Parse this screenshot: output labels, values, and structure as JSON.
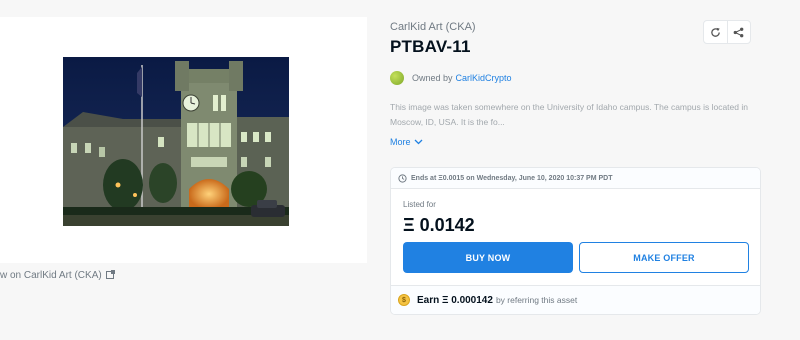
{
  "asset": {
    "collection": "CarlKid Art (CKA)",
    "title": "PTBAV-11",
    "owned_by_prefix": "Owned by",
    "owner": "CarlKidCrypto",
    "description": "This image was taken somewhere on the University of Idaho campus. The campus is located in Moscow, ID, USA. It is the fo...",
    "more_label": "More",
    "view_on_label": "w on CarlKid Art (CKA)"
  },
  "icons": {
    "refresh": "refresh-icon",
    "share": "share-icon",
    "external": "external-link-icon",
    "clock": "clock-icon",
    "chevron": "chevron-down-icon",
    "coin": "coin-icon"
  },
  "sale": {
    "ends_text": "Ends at Ξ0.0015 on Wednesday, June 10, 2020 10:37 PM PDT",
    "listed_label": "Listed for",
    "price": "Ξ 0.0142",
    "buy_label": "BUY NOW",
    "offer_label": "MAKE OFFER",
    "earn_amount": "Earn Ξ 0.000142",
    "earn_suffix": "by referring this asset",
    "coin_glyph": "$"
  },
  "colors": {
    "accent": "#2081e2",
    "title": "#04111d",
    "muted": "#707a83",
    "coin": "#f5c342"
  }
}
